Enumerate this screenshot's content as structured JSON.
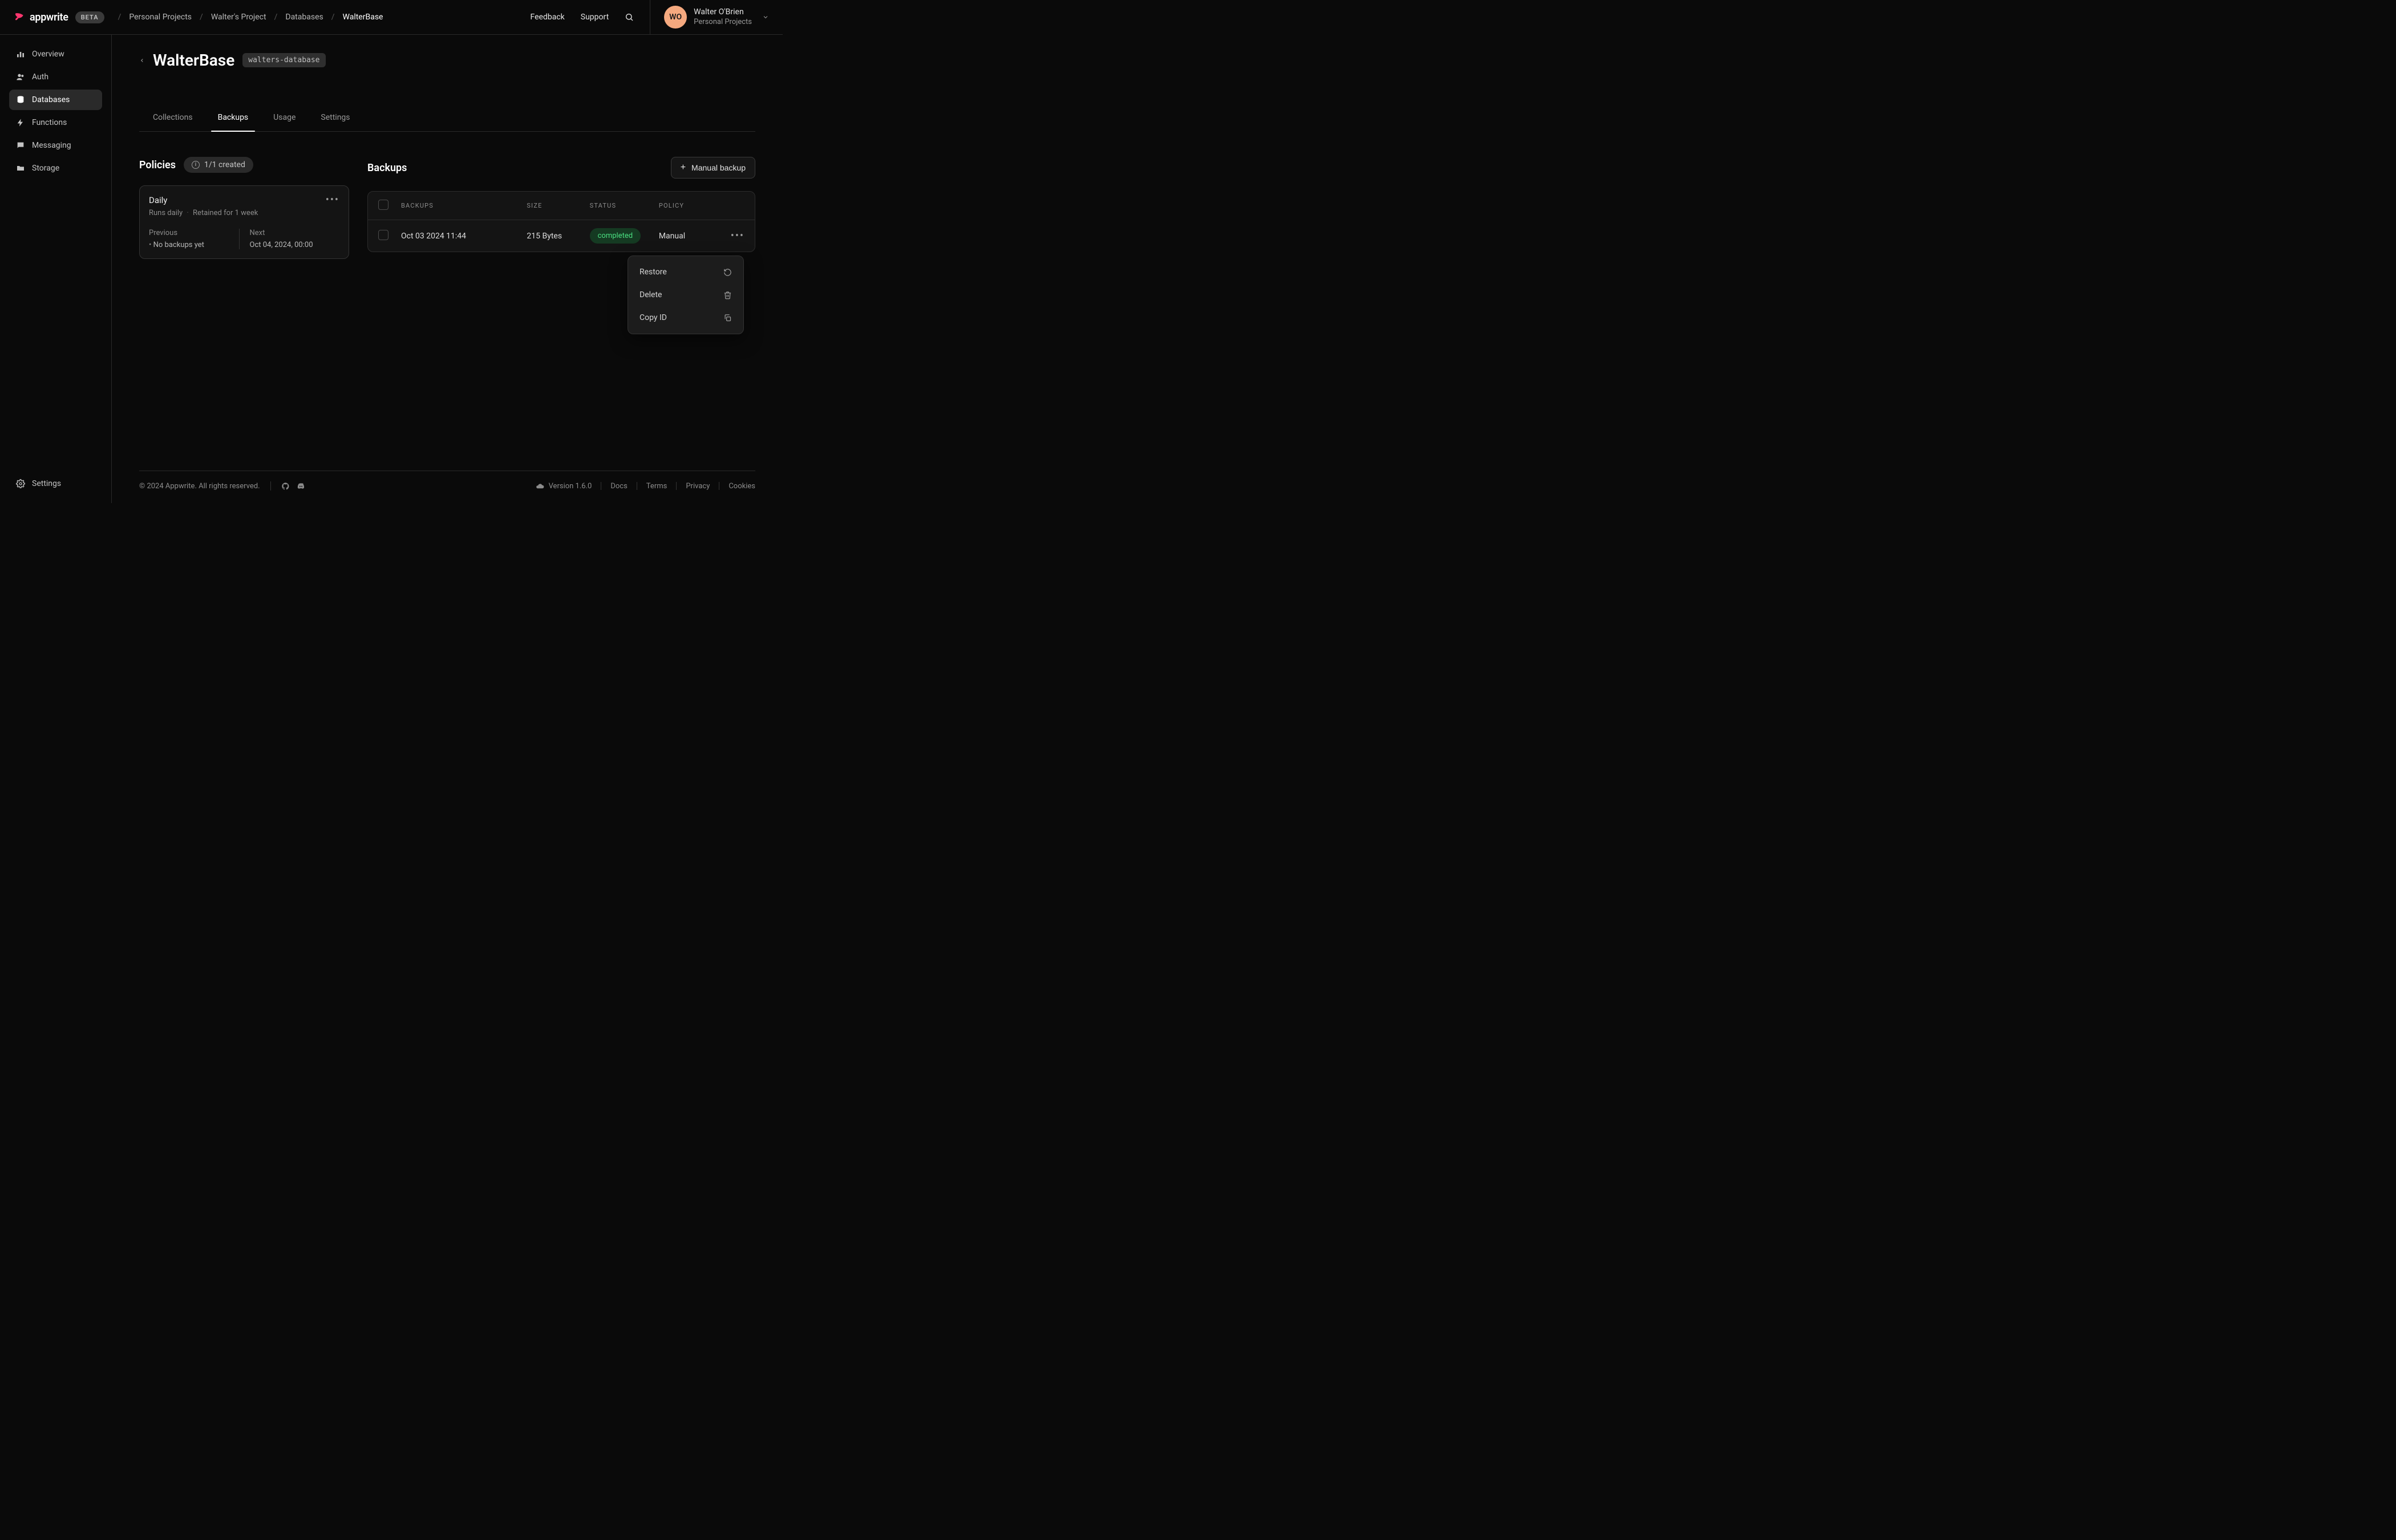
{
  "header": {
    "brand": "appwrite",
    "beta": "BETA",
    "breadcrumbs": [
      "Personal Projects",
      "Walter's Project",
      "Databases",
      "WalterBase"
    ],
    "links": {
      "feedback": "Feedback",
      "support": "Support"
    },
    "user": {
      "initials": "WO",
      "name": "Walter O'Brien",
      "org": "Personal Projects"
    }
  },
  "sidebar": {
    "items": [
      {
        "label": "Overview"
      },
      {
        "label": "Auth"
      },
      {
        "label": "Databases"
      },
      {
        "label": "Functions"
      },
      {
        "label": "Messaging"
      },
      {
        "label": "Storage"
      }
    ],
    "settings": "Settings"
  },
  "page": {
    "title": "WalterBase",
    "db_id": "walters-database",
    "tabs": [
      "Collections",
      "Backups",
      "Usage",
      "Settings"
    ]
  },
  "policies": {
    "title": "Policies",
    "count": "1/1 created",
    "card": {
      "name": "Daily",
      "schedule": "Runs daily",
      "retention": "Retained for 1 week",
      "prev_label": "Previous",
      "prev_value": "No backups yet",
      "next_label": "Next",
      "next_value": "Oct 04, 2024, 00:00"
    }
  },
  "backups": {
    "title": "Backups",
    "manual_btn": "Manual backup",
    "columns": {
      "backups": "BACKUPS",
      "size": "SIZE",
      "status": "STATUS",
      "policy": "POLICY"
    },
    "rows": [
      {
        "date": "Oct 03 2024 11:44",
        "size": "215 Bytes",
        "status": "completed",
        "policy": "Manual"
      }
    ]
  },
  "menu": {
    "restore": "Restore",
    "delete": "Delete",
    "copy_id": "Copy ID"
  },
  "footer": {
    "copyright": "© 2024 Appwrite. All rights reserved.",
    "version": "Version 1.6.0",
    "links": {
      "docs": "Docs",
      "terms": "Terms",
      "privacy": "Privacy",
      "cookies": "Cookies"
    }
  }
}
